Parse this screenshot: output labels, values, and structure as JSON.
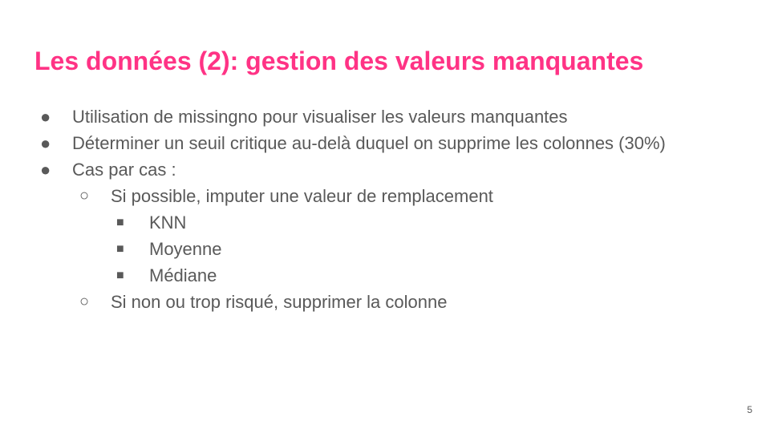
{
  "slide": {
    "title": "Les données (2): gestion des valeurs manquantes",
    "title_color": "#ff3385",
    "text_color": "#595959",
    "page_number": "5",
    "bullets": [
      {
        "marker": "●",
        "text": "Utilisation de missingno pour visualiser les valeurs manquantes"
      },
      {
        "marker": "●",
        "text": "Déterminer un seuil critique au-delà duquel on supprime les colonnes (30%)"
      },
      {
        "marker": "●",
        "text": "Cas par cas :"
      },
      {
        "marker": "○",
        "text": "Si possible, imputer une valeur de remplacement"
      },
      {
        "marker": "■",
        "text": "KNN"
      },
      {
        "marker": "■",
        "text": "Moyenne"
      },
      {
        "marker": "■",
        "text": "Médiane"
      },
      {
        "marker": "○",
        "text": "Si non ou trop risqué, supprimer la colonne"
      }
    ]
  }
}
